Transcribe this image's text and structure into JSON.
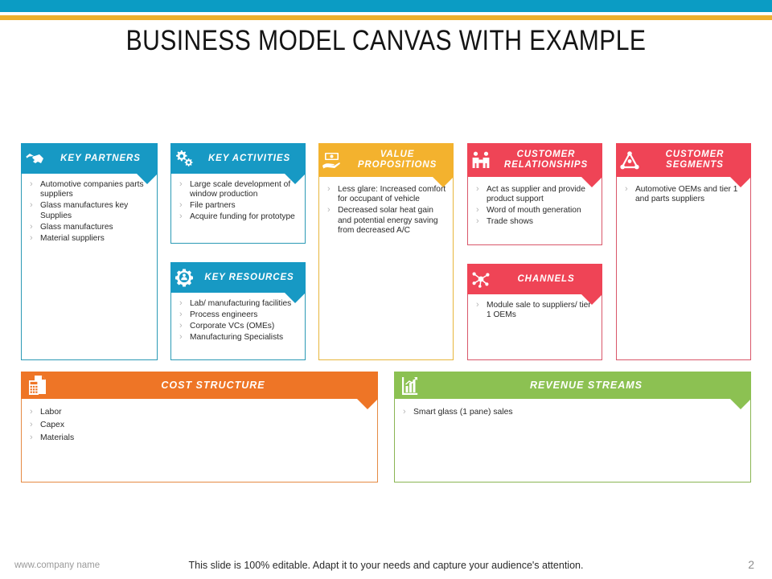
{
  "slide": {
    "title": "BUSINESS MODEL CANVAS  WITH EXAMPLE",
    "top_bar_teal_color": "#0b9cc4",
    "top_bar_gold_color": "#edb02e"
  },
  "blocks": {
    "key_partners": {
      "title": "KEY PARTNERS",
      "icon": "handshake-icon",
      "color": "#1799c4",
      "items": [
        "Automotive companies parts suppliers",
        "Glass manufactures key Supplies",
        "Glass manufactures",
        "Material suppliers"
      ]
    },
    "key_activities": {
      "title": "KEY ACTIVITIES",
      "icon": "gears-icon",
      "color": "#1799c4",
      "items": [
        "Large scale development of window production",
        "File  partners",
        "Acquire funding for prototype"
      ]
    },
    "key_resources": {
      "title": "KEY RESOURCES",
      "icon": "gear-person-icon",
      "color": "#1799c4",
      "items": [
        "Lab/ manufacturing facilities",
        "Process engineers",
        "Corporate VCs (OMEs)",
        "Manufacturing Specialists"
      ]
    },
    "value_propositions": {
      "title_line1": "VALUE",
      "title_line2": "PROPOSITIONS",
      "icon": "money-hand-icon",
      "color": "#f3b22e",
      "items": [
        "Less glare: Increased comfort for occupant of vehicle",
        "Decreased solar heat gain and potential energy saving from decreased A/C"
      ]
    },
    "customer_relationships": {
      "title_line1": "CUSTOMER",
      "title_line2": "RELATIONSHIPS",
      "icon": "two-people-icon",
      "color": "#ef4456",
      "items": [
        "Act as supplier and provide product support",
        "Word of mouth  generation",
        "Trade shows"
      ]
    },
    "channels": {
      "title": "CHANNELS",
      "icon": "network-hub-icon",
      "color": "#ef4456",
      "items": [
        "Module  sale to suppliers/ tier 1 OEMs"
      ]
    },
    "customer_segments": {
      "title_line1": "CUSTOMER",
      "title_line2": "SEGMENTS",
      "icon": "network-triangle-icon",
      "color": "#ef4456",
      "items": [
        "Automotive OEMs  and tier 1 and parts suppliers"
      ]
    },
    "cost_structure": {
      "title": "COST STRUCTURE",
      "icon": "calculator-document-icon",
      "color": "#ee7526",
      "items": [
        "Labor",
        "Capex",
        "Materials"
      ]
    },
    "revenue_streams": {
      "title": "REVENUE STREAMS",
      "icon": "bar-chart-icon",
      "color": "#8cc152",
      "items": [
        "Smart glass (1 pane) sales"
      ]
    }
  },
  "footer": {
    "website": "www.company name",
    "note": "This slide is 100% editable.  Adapt it to your needs and capture your audience's attention.",
    "page_number": "2"
  }
}
